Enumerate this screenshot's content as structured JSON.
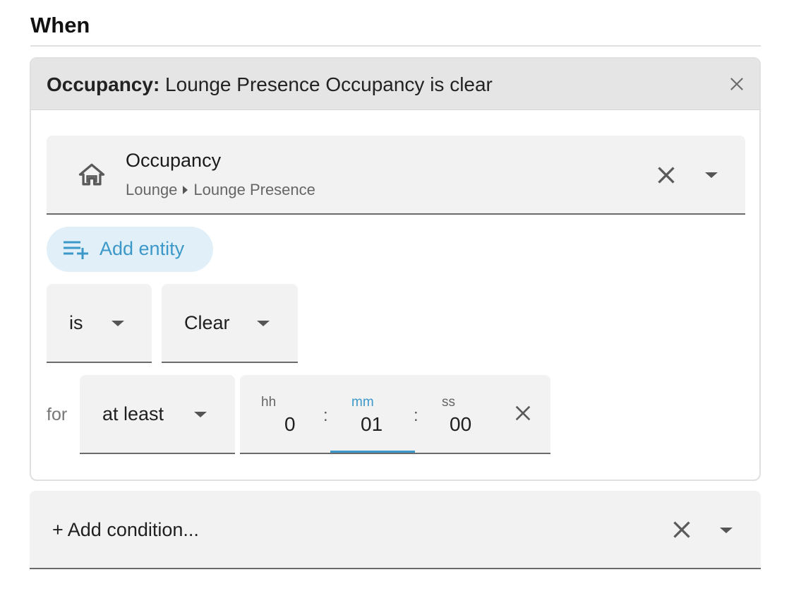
{
  "section": {
    "title": "When"
  },
  "trigger": {
    "header_type": "Occupancy:",
    "header_text": " Lounge Presence Occupancy is clear",
    "entity": {
      "name": "Occupancy",
      "area": "Lounge",
      "device": "Lounge Presence",
      "icon": "home-outline-icon"
    },
    "add_entity_label": "Add entity",
    "state_operator": "is",
    "state_value": "Clear",
    "for_label": "for",
    "for_operator": "at least",
    "duration": {
      "hh_label": "hh",
      "hh": "0",
      "mm_label": "mm",
      "mm": "01",
      "ss_label": "ss",
      "ss": "00",
      "separator": ":"
    }
  },
  "add_condition": {
    "placeholder": "+ Add condition..."
  },
  "colors": {
    "accent": "#3c98c9",
    "header_bg": "#e5e5e5",
    "field_bg": "#f2f2f2"
  }
}
